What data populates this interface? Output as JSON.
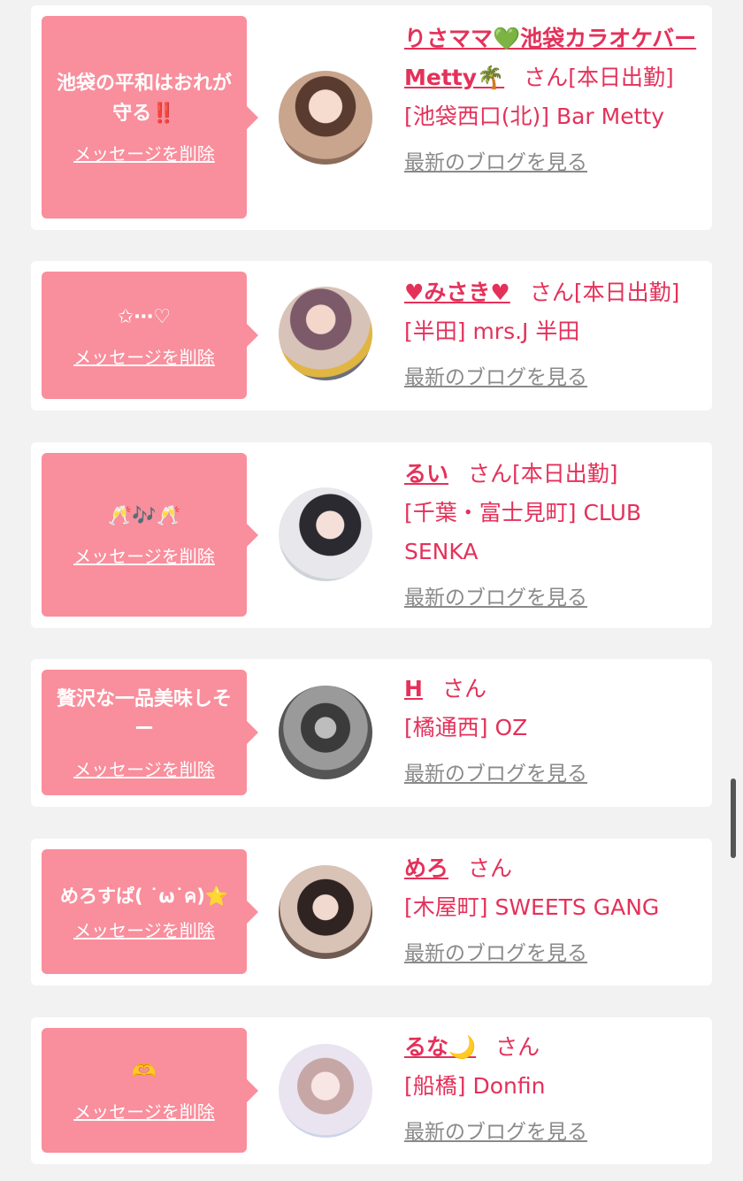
{
  "cards": [
    {
      "message": "池袋の平和はおれが守る‼️",
      "delete_label": "メッセージを削除",
      "name": "りさママ💚池袋カラオケバーMetty🌴",
      "honorific": "さん",
      "status": "[本日出勤]",
      "shop": "[池袋西口(北)] Bar Metty",
      "blog_label": "最新のブログを見る"
    },
    {
      "message": "✩⋯♡",
      "delete_label": "メッセージを削除",
      "name": "♥みさき♥",
      "honorific": "さん",
      "status": "[本日出勤]",
      "shop": "[半田] mrs.J 半田",
      "blog_label": "最新のブログを見る"
    },
    {
      "message": "🥂🎶🥂",
      "delete_label": "メッセージを削除",
      "name": "るい",
      "honorific": "さん",
      "status": "[本日出勤]",
      "shop": "[千葉・富士見町] CLUB SENKA",
      "blog_label": "最新のブログを見る"
    },
    {
      "message": "贅沢な一品美味しそー",
      "delete_label": "メッセージを削除",
      "name": "H",
      "honorific": "さん",
      "status": "",
      "shop": "[橘通西] OZ",
      "blog_label": "最新のブログを見る"
    },
    {
      "message": "めろすぱ( ˙ω˙ค)⭐️",
      "delete_label": "メッセージを削除",
      "name": "めろ",
      "honorific": "さん",
      "status": "",
      "shop": "[木屋町] SWEETS GANG",
      "blog_label": "最新のブログを見る"
    },
    {
      "message": "🫶",
      "delete_label": "メッセージを削除",
      "name": "るな🌙",
      "honorific": "さん",
      "status": "",
      "shop": "[船橋] Donfin",
      "blog_label": "最新のブログを見る"
    }
  ],
  "colors": {
    "accent": "#e4315a",
    "bubble": "#f98e9c",
    "background": "#f2f2f2",
    "link_gray": "#8a8a8a"
  }
}
